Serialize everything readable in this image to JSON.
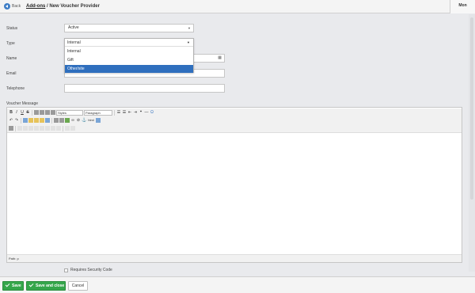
{
  "header": {
    "back_label": "Back",
    "breadcrumb_link": "Add-ons",
    "breadcrumb_sep": " / ",
    "page_title": "New Voucher Provider",
    "right_tab": "Mon"
  },
  "form": {
    "status": {
      "label": "Status",
      "value": "Active"
    },
    "type": {
      "label": "Type",
      "value": "Internal",
      "options": [
        "Internal",
        "Gift",
        "Other/site"
      ],
      "selected_index": 2
    },
    "name": {
      "label": "Name",
      "value": ""
    },
    "email": {
      "label": "Email",
      "value": ""
    },
    "telephone": {
      "label": "Telephone",
      "value": ""
    },
    "voucher_message": {
      "label": "Voucher Message"
    }
  },
  "editor": {
    "styles_select": "Styles",
    "paragraph_select": "Paragraph",
    "path_label": "Path: p"
  },
  "captcha": {
    "label": "Requires Security Code"
  },
  "footer": {
    "save": "Save",
    "save_close": "Save and close",
    "cancel": "Cancel"
  }
}
